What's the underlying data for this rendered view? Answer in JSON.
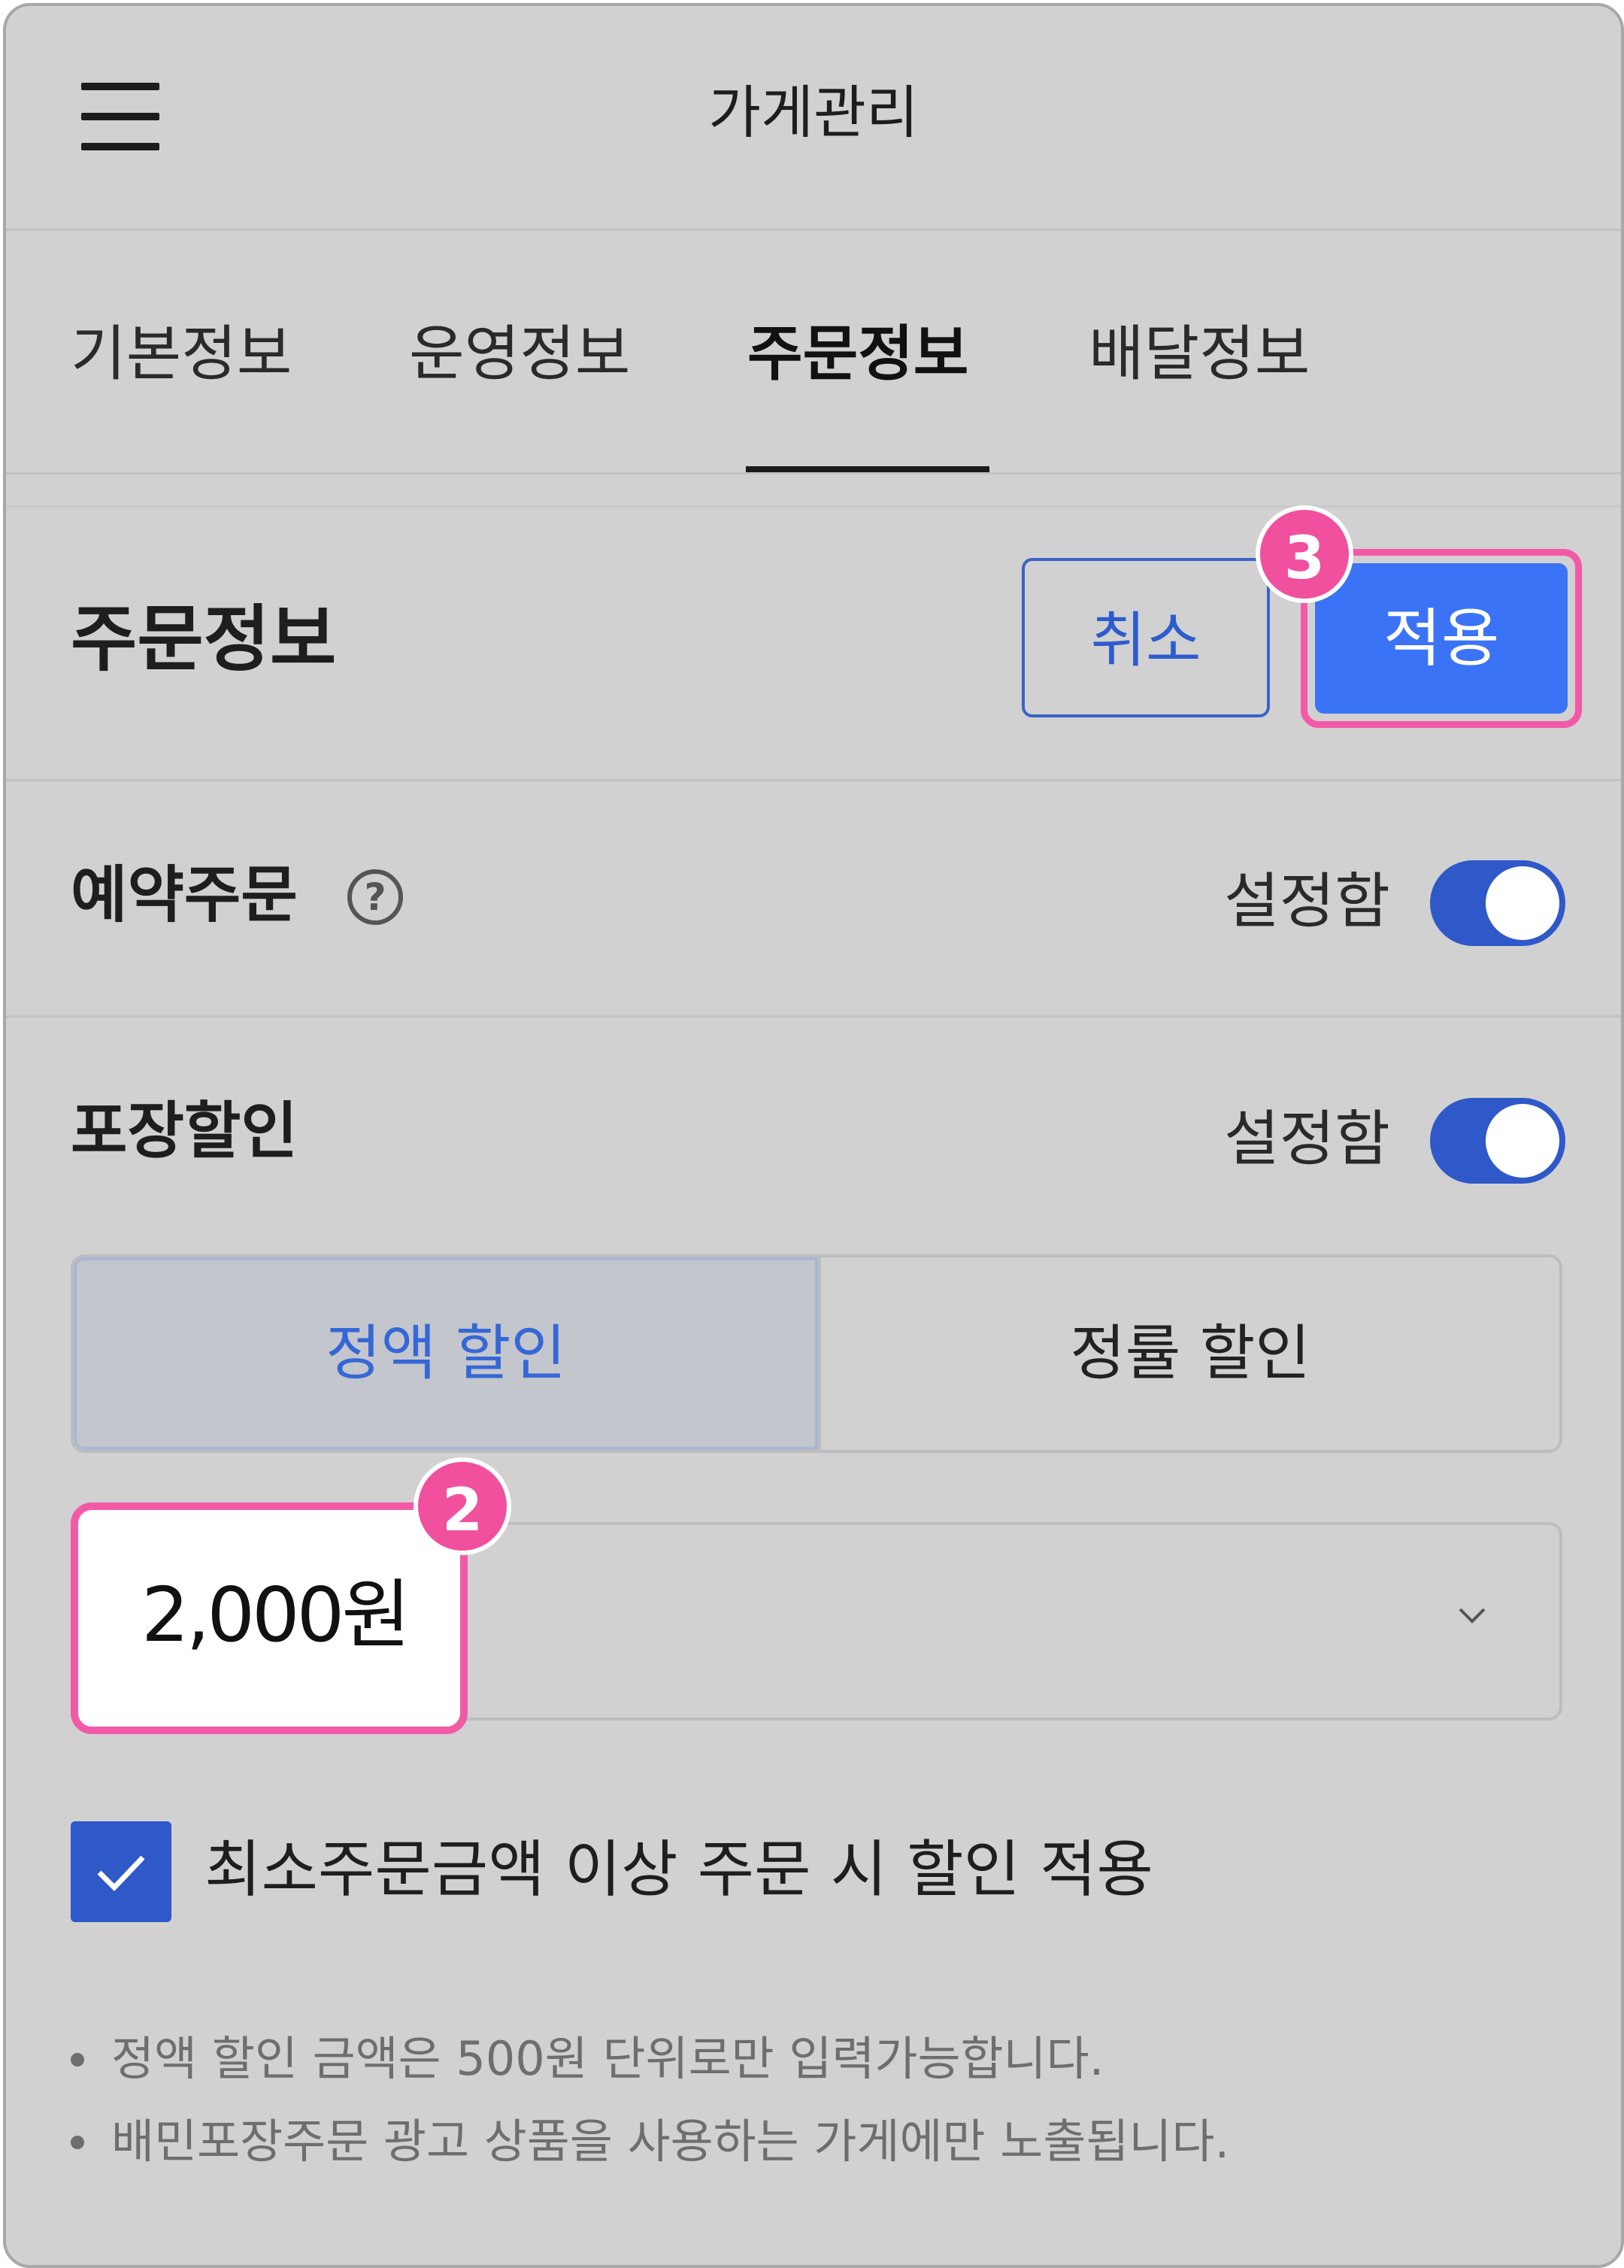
{
  "header": {
    "title": "가게관리",
    "menu_icon": "hamburger-menu-icon"
  },
  "tabs": [
    {
      "label": "기본정보",
      "active": false
    },
    {
      "label": "운영정보",
      "active": false
    },
    {
      "label": "주문정보",
      "active": true
    },
    {
      "label": "배달정보",
      "active": false
    }
  ],
  "section": {
    "title": "주문정보",
    "cancel_label": "취소",
    "apply_label": "적용"
  },
  "annotations": {
    "apply_step": "3",
    "amount_step": "2"
  },
  "reservation": {
    "label": "예약주문",
    "help_icon": "question-circle-icon",
    "help_glyph": "?",
    "status_text": "설정함",
    "enabled": true
  },
  "pickup_discount": {
    "label": "포장할인",
    "status_text": "설정함",
    "enabled": true,
    "options": [
      "정액 할인",
      "정률 할인"
    ],
    "selected_option": "정액 할인",
    "amount": "2,000원",
    "select_icon": "chevron-down-icon",
    "min_order_checkbox": {
      "checked": true,
      "label": "최소주문금액 이상 주문 시 할인 적용"
    }
  },
  "notes": [
    "정액 할인 금액은 500원 단위로만 입력가능합니다.",
    "배민포장주문 광고 상품을 사용하는 가게에만 노출됩니다."
  ],
  "colors": {
    "primary": "#3a73f5",
    "toggle_on": "#2f58c9",
    "highlight": "#f25aa8",
    "background": "#d1d1d1"
  }
}
